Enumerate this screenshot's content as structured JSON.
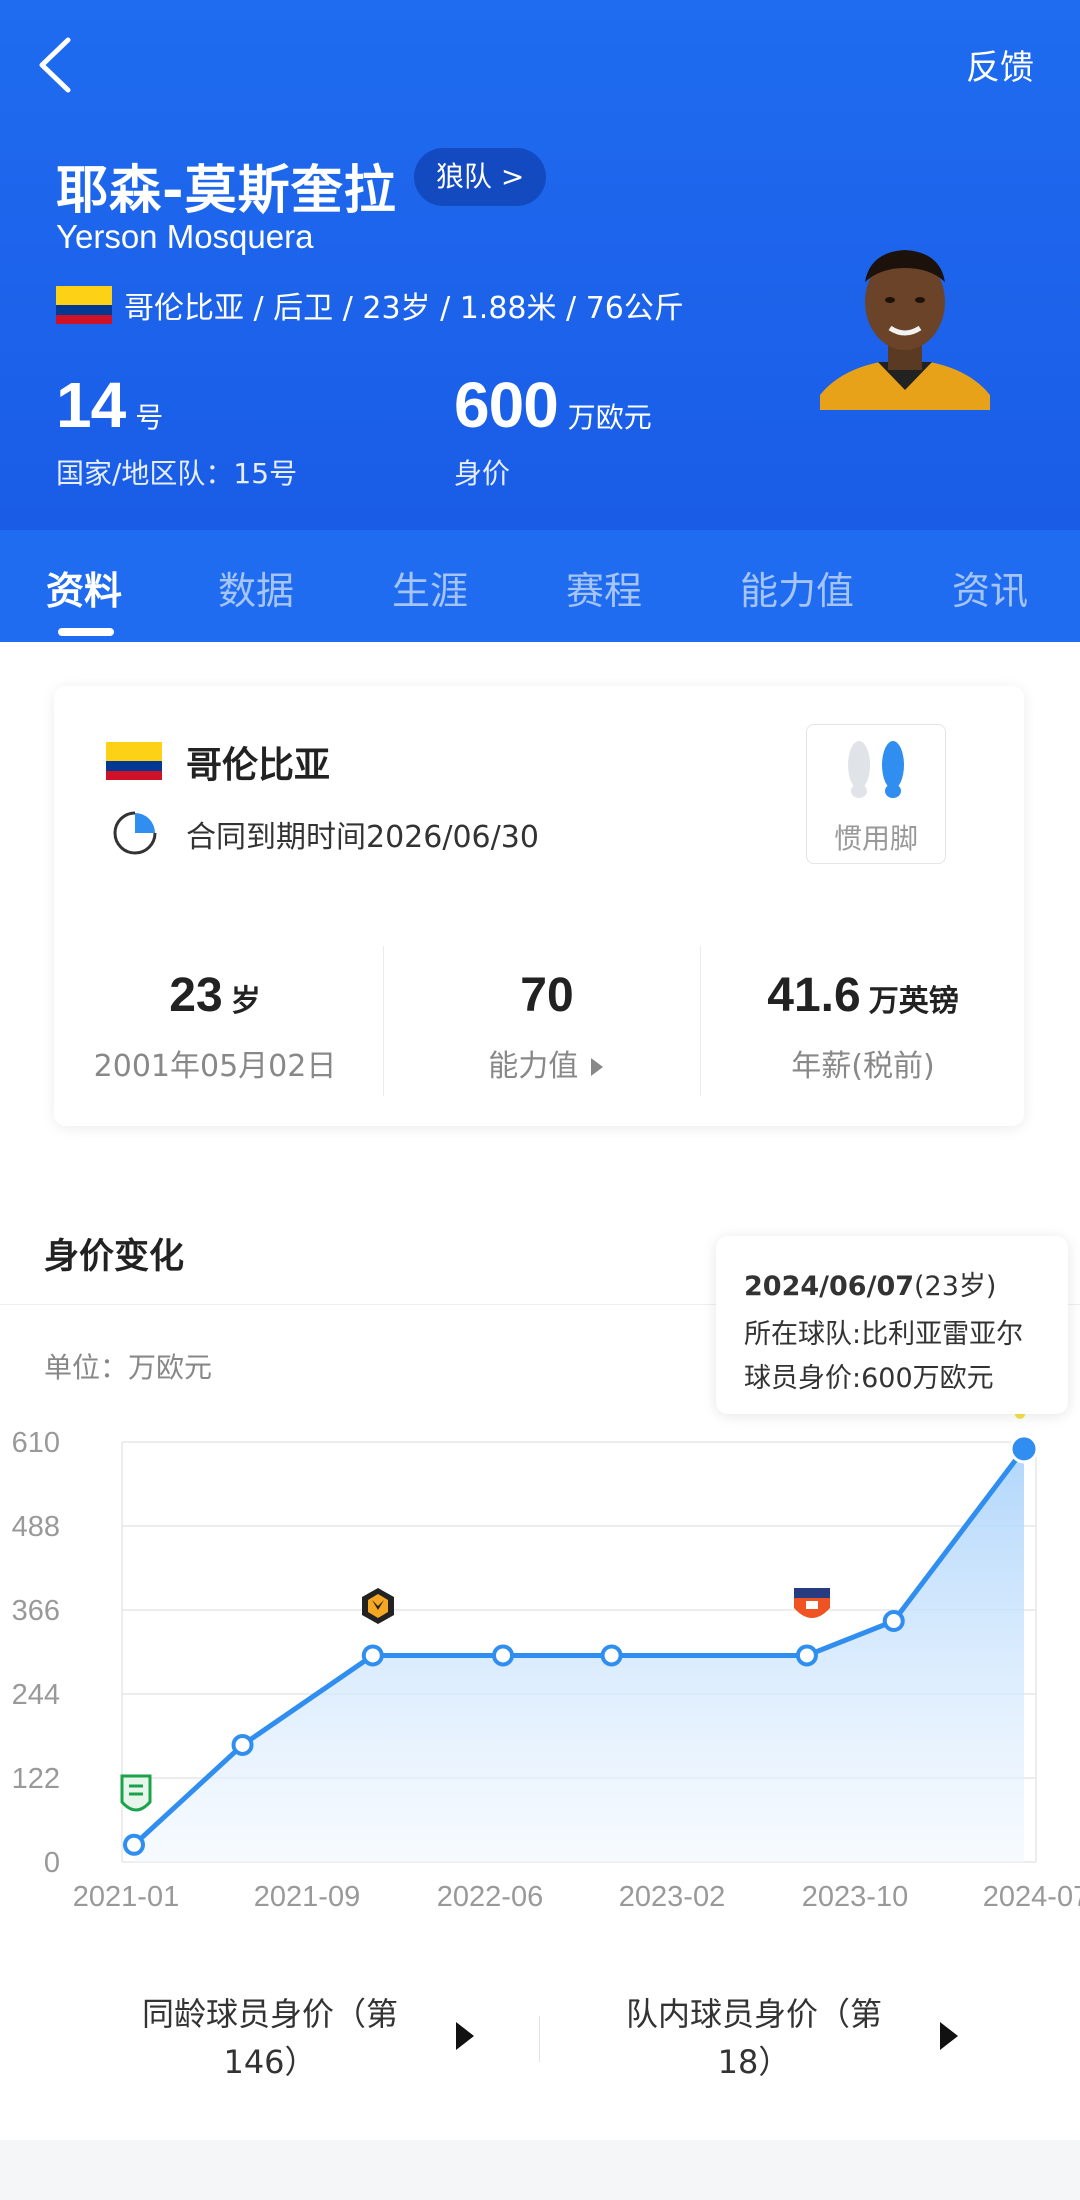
{
  "header": {
    "feedback": "反馈",
    "name_cn": "耶森-莫斯奎拉",
    "team_pill": "狼队 >",
    "name_en": "Yerson Mosquera",
    "info": "哥伦比亚 / 后卫 / 23岁 / 1.88米 / 76公斤",
    "shirt_number": "14",
    "shirt_unit": "号",
    "national_number": "国家/地区队：15号",
    "market_value": "600",
    "market_value_unit": "万欧元",
    "market_value_label": "身价"
  },
  "tabs": [
    {
      "label": "资料",
      "active": true
    },
    {
      "label": "数据"
    },
    {
      "label": "生涯"
    },
    {
      "label": "赛程"
    },
    {
      "label": "能力值"
    },
    {
      "label": "资讯"
    }
  ],
  "profile_card": {
    "country": "哥伦比亚",
    "contract": "合同到期时间2026/06/30",
    "foot_label": "惯用脚",
    "stats": [
      {
        "value": "23",
        "unit": "岁",
        "label": "2001年05月02日"
      },
      {
        "value": "70",
        "unit": "",
        "label": "能力值"
      },
      {
        "value": "41.6",
        "unit": "万英镑",
        "label": "年薪(税前)"
      }
    ]
  },
  "value_section": {
    "title": "身价变化",
    "unit_label": "单位：万欧元",
    "tooltip": {
      "date": "2024/06/07",
      "age": "(23岁)",
      "team": "所在球队:比利亚雷亚尔",
      "value": "球员身价:600万欧元"
    }
  },
  "chart_data": {
    "type": "area",
    "ylim": [
      0,
      610
    ],
    "yticks": [
      0,
      122,
      244,
      366,
      488,
      610
    ],
    "xtick_labels": [
      "2021-01",
      "2021-09",
      "2022-06",
      "2023-02",
      "2023-10",
      "2024-07"
    ],
    "points": [
      {
        "x": "2021-01",
        "y": 25
      },
      {
        "x": "2021-06",
        "y": 170
      },
      {
        "x": "2021-12",
        "y": 300
      },
      {
        "x": "2022-06",
        "y": 300
      },
      {
        "x": "2022-11",
        "y": 300
      },
      {
        "x": "2023-08",
        "y": 300
      },
      {
        "x": "2023-12",
        "y": 350
      },
      {
        "x": "2024-06",
        "y": 600
      }
    ],
    "grid": true,
    "colors": {
      "line": "#2f8ef0",
      "fill_top": "#a9d2fb",
      "fill_bottom": "#f2f8ff"
    }
  },
  "rankings": {
    "age_peers": "同龄球员身价（第\n146）",
    "team": "队内球员身价（第\n18）"
  },
  "colors": {
    "header_blue": "#1f6cf0",
    "accent_blue": "#2f8ef0"
  }
}
